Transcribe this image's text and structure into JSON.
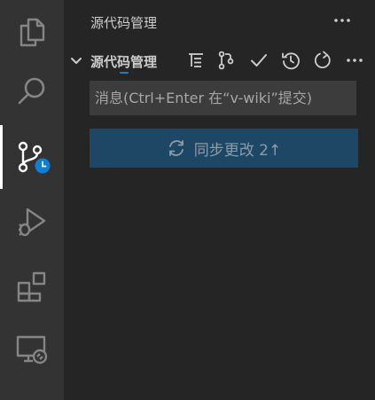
{
  "activity_bar": {
    "items": [
      {
        "icon": "files-icon"
      },
      {
        "icon": "search-icon"
      },
      {
        "icon": "source-control-icon",
        "active": true,
        "badge_icon": "clock-icon"
      },
      {
        "icon": "run-debug-icon"
      },
      {
        "icon": "extensions-icon"
      },
      {
        "icon": "remote-explorer-icon"
      }
    ]
  },
  "sidebar": {
    "title": "源代码管理",
    "more_icon": "ellipsis-icon"
  },
  "section": {
    "title": "源代码管理",
    "chevron_icon": "chevron-down-icon",
    "toolbar_icons": [
      "tree-view-icon",
      "branch-icon",
      "check-icon",
      "history-icon",
      "refresh-icon",
      "ellipsis-icon"
    ]
  },
  "commit": {
    "placeholder": "消息(Ctrl+Enter 在“v-wiki”提交)",
    "value": ""
  },
  "sync": {
    "label": "同步更改 2↑",
    "icon": "sync-icon"
  },
  "colors": {
    "activity_bar": "#333333",
    "sidebar": "#252526",
    "accent": "#0e83d0",
    "sync_button": "#1e4765"
  }
}
